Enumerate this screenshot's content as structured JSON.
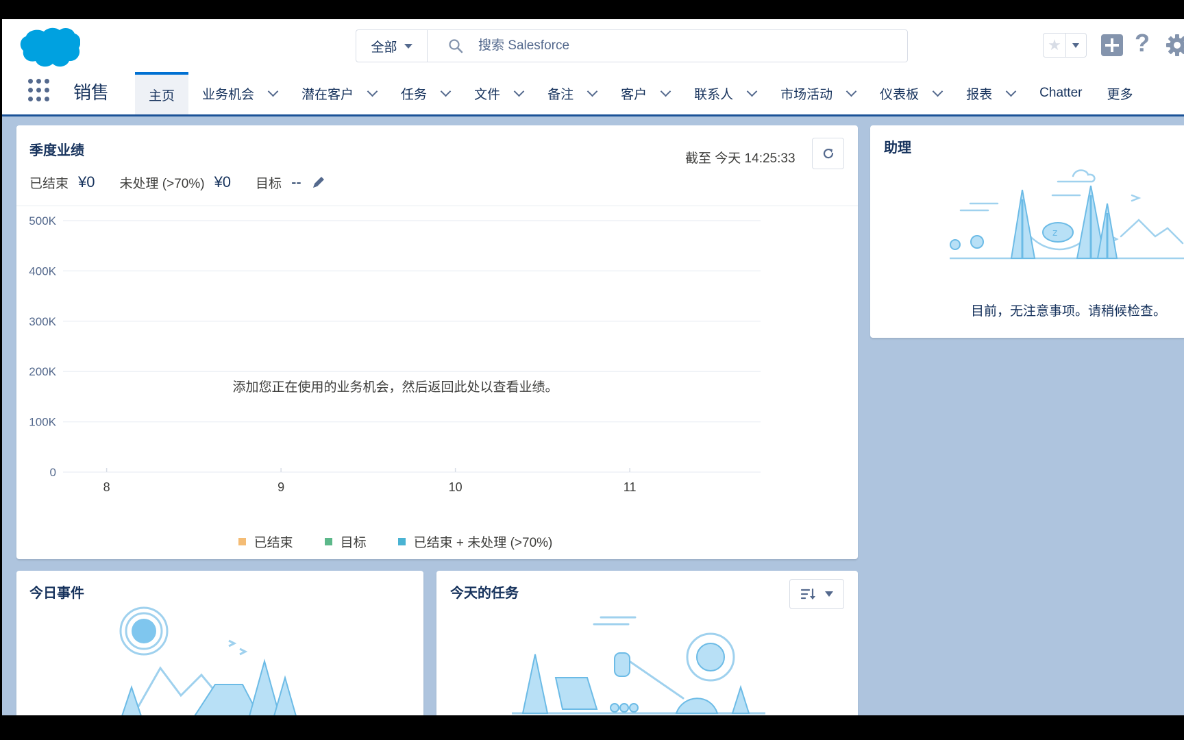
{
  "header": {
    "search_scope": "全部",
    "search_placeholder": "搜索 Salesforce",
    "icons": [
      "salesforce-cloud-logo",
      "search-icon",
      "star-icon",
      "add-icon",
      "help-icon",
      "gear-icon"
    ]
  },
  "nav": {
    "app_name": "销售",
    "tabs": [
      {
        "label": "主页",
        "active": true,
        "has_menu": false
      },
      {
        "label": "业务机会",
        "active": false,
        "has_menu": true
      },
      {
        "label": "潜在客户",
        "active": false,
        "has_menu": true
      },
      {
        "label": "任务",
        "active": false,
        "has_menu": true
      },
      {
        "label": "文件",
        "active": false,
        "has_menu": true
      },
      {
        "label": "备注",
        "active": false,
        "has_menu": true
      },
      {
        "label": "客户",
        "active": false,
        "has_menu": true
      },
      {
        "label": "联系人",
        "active": false,
        "has_menu": true
      },
      {
        "label": "市场活动",
        "active": false,
        "has_menu": true
      },
      {
        "label": "仪表板",
        "active": false,
        "has_menu": true
      },
      {
        "label": "报表",
        "active": false,
        "has_menu": true
      },
      {
        "label": "Chatter",
        "active": false,
        "has_menu": false
      },
      {
        "label": "更多",
        "active": false,
        "has_menu": false
      }
    ]
  },
  "performance": {
    "title": "季度业绩",
    "as_of": "截至 今天 14:25:33",
    "closed_label": "已结束",
    "closed_value": "¥0",
    "open_label": "未处理 (>70%)",
    "open_value": "¥0",
    "goal_label": "目标",
    "goal_value": "--",
    "empty_message": "添加您正在使用的业务机会，然后返回此处以查看业绩。"
  },
  "chart_data": {
    "type": "line",
    "x": [
      8,
      9,
      10,
      11
    ],
    "x_tick_labels": [
      "8",
      "9",
      "10",
      "11"
    ],
    "y_tick_labels": [
      "0",
      "100K",
      "200K",
      "300K",
      "400K",
      "500K"
    ],
    "ylim": [
      0,
      500000
    ],
    "grid": true,
    "legend_position": "bottom",
    "series": [
      {
        "name": "已结束",
        "color": "#f4bc75",
        "values": []
      },
      {
        "name": "目标",
        "color": "#5cb88a",
        "values": []
      },
      {
        "name": "已结束 + 未处理 (>70%)",
        "color": "#4ab3d3",
        "values": []
      }
    ]
  },
  "assistant": {
    "title": "助理",
    "message": "目前，无注意事项。请稍候检查。"
  },
  "events": {
    "title": "今日事件"
  },
  "tasks": {
    "title": "今天的任务"
  }
}
